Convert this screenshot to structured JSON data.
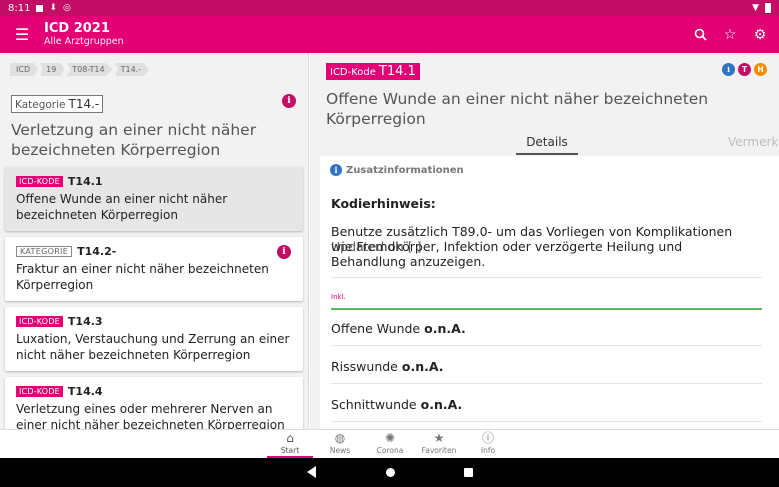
{
  "status": {
    "time": "8:11"
  },
  "appbar": {
    "title": "ICD 2021",
    "subtitle": "Alle Arztgruppen"
  },
  "breadcrumb": [
    "ICD",
    "19",
    "T08-T14",
    "T14.-"
  ],
  "left": {
    "kategorie_label": "Kategorie",
    "kategorie_code": "T14.-",
    "heading": "Verletzung an einer nicht näher bezeichneten Körperregion"
  },
  "list": [
    {
      "tag": "ICD-KODE",
      "code": "T14.1",
      "title": "Offene Wunde an einer nicht näher bezeichneten Körperregion"
    },
    {
      "tag": "KATEGORIE",
      "code": "T14.2-",
      "title": "Fraktur an einer nicht näher bezeichneten Körperregion"
    },
    {
      "tag": "ICD-KODE",
      "code": "T14.3",
      "title": "Luxation, Verstauchung und Zerrung an einer nicht näher bezeichneten Körperregion"
    },
    {
      "tag": "ICD-KODE",
      "code": "T14.4",
      "title": "Verletzung eines oder mehrerer Nerven an einer nicht näher bezeichneten Körperregion"
    }
  ],
  "detail": {
    "kode_label": "ICD-Kode",
    "code": "T14.1",
    "badges": [
      "i",
      "T",
      "H"
    ],
    "title": "Offene Wunde an einer nicht näher bezeichneten Körperregion",
    "tabs": [
      "Details",
      "Vermerk"
    ],
    "zusatz": "Zusatzinformationen",
    "hinweis_title": "Kodierhinweis:",
    "hinweis_text": "Benutze zusätzlich T89.0- um das Vorliegen von Komplikationen wie Fremdkörper, Infektion oder verzögerte Heilung und Behandlung anzuzeigen.",
    "overlay_text": "Updated on [ ]",
    "inkl_label": "Inkl.",
    "inkl_items": [
      {
        "text": "Offene Wunde",
        "suffix": "o.n.A."
      },
      {
        "text": "Risswunde",
        "suffix": "o.n.A."
      },
      {
        "text": "Schnittwunde",
        "suffix": "o.n.A."
      }
    ]
  },
  "bottomnav": [
    {
      "label": "Start",
      "icon": "home-icon"
    },
    {
      "label": "News",
      "icon": "globe-icon"
    },
    {
      "label": "Corona",
      "icon": "virus-icon"
    },
    {
      "label": "Favoriten",
      "icon": "star-icon"
    },
    {
      "label": "Info",
      "icon": "info-icon"
    }
  ],
  "colors": {
    "brand": "#e20074",
    "statusbar": "#c40d65",
    "success": "#5cb85c",
    "info": "#2f74c0",
    "badge_t": "#c40d65",
    "badge_h": "#f28c00"
  }
}
